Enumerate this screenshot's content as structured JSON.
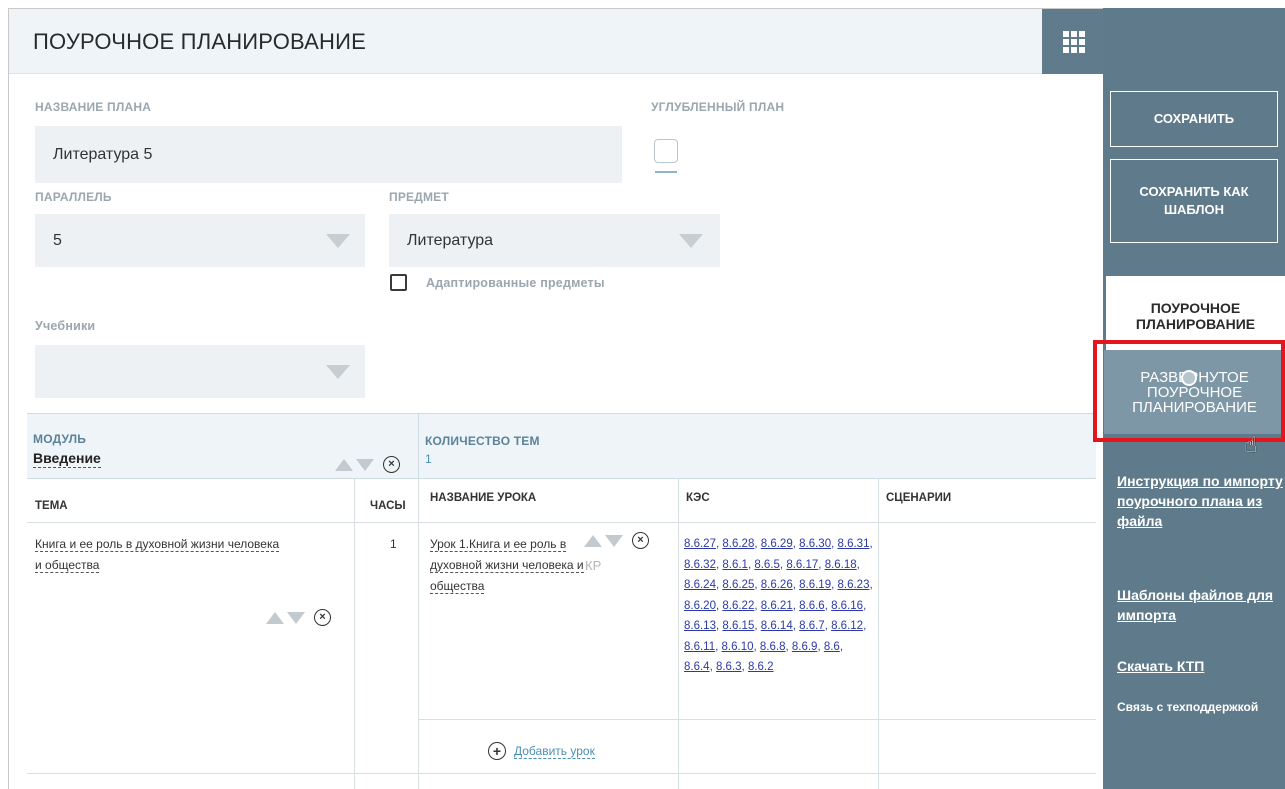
{
  "header": {
    "title": "ПОУРОЧНОЕ ПЛАНИРОВАНИЕ",
    "apps_icon": "apps-grid-icon"
  },
  "form": {
    "plan_name_label": "НАЗВАНИЕ ПЛАНА",
    "plan_name_value": "Литература 5",
    "advanced_plan_label": "УГЛУБЛЕННЫЙ ПЛАН",
    "parallel_label": "ПАРАЛЛЕЛЬ",
    "parallel_value": "5",
    "subject_label": "ПРЕДМЕТ",
    "subject_value": "Литература",
    "adapted_label": "Адаптированные предметы",
    "textbooks_label": "Учебники",
    "textbooks_value": ""
  },
  "module": {
    "module_label": "МОДУЛЬ",
    "module_value": "Введение",
    "count_label": "КОЛИЧЕСТВО ТЕМ",
    "count_value": "1"
  },
  "table": {
    "headers": {
      "topic": "ТЕМА",
      "hours": "ЧАСЫ",
      "lesson": "НАЗВАНИЕ УРОКА",
      "kes": "КЭС",
      "scenarios": "СЦЕНАРИИ"
    },
    "rows": [
      {
        "topic": "Книга и ее роль в духовной жизни человека и общества",
        "hours": "1",
        "lesson": "Урок 1.Книга и ее роль в духовной жизни человека и общества",
        "kp": "КР",
        "kes_codes": [
          "8.6.27",
          "8.6.28",
          "8.6.29",
          "8.6.30",
          "8.6.31",
          "8.6.32",
          "8.6.1",
          "8.6.5",
          "8.6.17",
          "8.6.18",
          "8.6.24",
          "8.6.25",
          "8.6.26",
          "8.6.19",
          "8.6.23",
          "8.6.20",
          "8.6.22",
          "8.6.21",
          "8.6.6",
          "8.6.16",
          "8.6.13",
          "8.6.15",
          "8.6.14",
          "8.6.7",
          "8.6.12",
          "8.6.11",
          "8.6.10",
          "8.6.8",
          "8.6.9",
          "8.6",
          "8.6.4",
          "8.6.3",
          "8.6.2"
        ]
      }
    ],
    "add_lesson": "Добавить урок"
  },
  "sidebar": {
    "save": "СОХРАНИТЬ",
    "save_as_template": "СОХРАНИТЬ КАК ШАБЛОН",
    "tab_lesson_planning": "ПОУРОЧНОЕ ПЛАНИРОВАНИЕ",
    "tab_expanded_planning": "РАЗВЕРНУТОЕ ПОУРОЧНОЕ ПЛАНИРОВАНИЕ",
    "link_import_instructions": "Инструкция по импорту поурочного плана из файла",
    "link_templates": "Шаблоны файлов для импорта",
    "link_download": "Скачать КТП",
    "support": "Связь с техподдержкой"
  },
  "colors": {
    "sidebar_bg": "#5f7a8a",
    "highlight_border": "#e4161c",
    "link": "#2b3aa8"
  }
}
